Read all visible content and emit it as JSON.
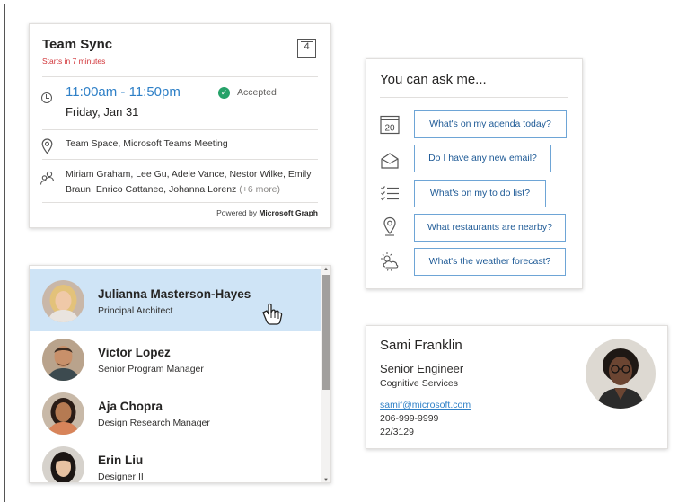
{
  "meeting": {
    "title": "Team Sync",
    "starts": "Starts in 7 minutes",
    "calendar_day": "4",
    "time": "11:00am - 11:50pm",
    "date": "Friday, Jan 31",
    "status": "Accepted",
    "location": "Team Space, Microsoft Teams Meeting",
    "attendees": "Miriam Graham, Lee Gu, Adele Vance, Nestor Wilke, Emily Braun, Enrico Cattaneo, Johanna Lorenz",
    "more": "(+6 more)",
    "powered_prefix": "Powered by",
    "powered_brand": "Microsoft Graph"
  },
  "ask": {
    "title": "You can ask me...",
    "calendar_day": "20",
    "suggestions": [
      {
        "label": "What's on my agenda today?",
        "icon": "calendar-icon"
      },
      {
        "label": "Do I have any new email?",
        "icon": "mail-icon"
      },
      {
        "label": "What's on my to do list?",
        "icon": "todo-list-icon"
      },
      {
        "label": "What restaurants are nearby?",
        "icon": "location-pin-icon"
      },
      {
        "label": "What's the weather forecast?",
        "icon": "weather-icon"
      }
    ]
  },
  "people": [
    {
      "name": "Julianna Masterson-Hayes",
      "role": "Principal Architect"
    },
    {
      "name": "Victor Lopez",
      "role": "Senior Program Manager"
    },
    {
      "name": "Aja Chopra",
      "role": "Design Research Manager"
    },
    {
      "name": "Erin Liu",
      "role": "Designer II"
    }
  ],
  "contact": {
    "name": "Sami Franklin",
    "title": "Senior Engineer",
    "department": "Cognitive Services",
    "email": "samif@microsoft.com",
    "phone": "206-999-9999",
    "office": "22/3129"
  },
  "colors": {
    "accent": "#2f80c7",
    "highlight": "#cfe4f6",
    "accepted": "#26a269",
    "alert": "#d13438"
  }
}
